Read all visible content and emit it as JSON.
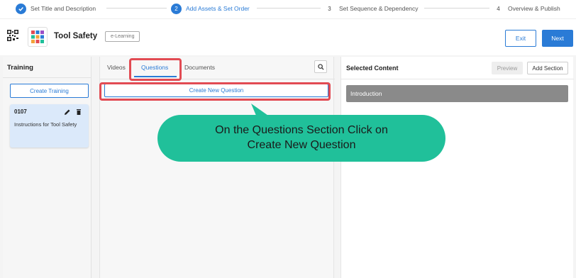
{
  "stepper": {
    "steps": [
      {
        "number": "1",
        "label": "Set Title and Description",
        "state": "done"
      },
      {
        "number": "2",
        "label": "Add Assets & Set Order",
        "state": "active"
      },
      {
        "number": "3",
        "label": "Set Sequence & Dependency",
        "state": "todo"
      },
      {
        "number": "4",
        "label": "Overview & Publish",
        "state": "todo"
      }
    ]
  },
  "header": {
    "title": "Tool Safety",
    "tag": "e-Learning",
    "exit_label": "Exit",
    "next_label": "Next"
  },
  "training": {
    "title": "Training",
    "create_label": "Create Training",
    "card": {
      "id": "0107",
      "description": "Instructions for Tool Safety"
    }
  },
  "assets": {
    "tabs": [
      {
        "label": "Videos",
        "active": false
      },
      {
        "label": "Questions",
        "active": true
      },
      {
        "label": "Documents",
        "active": false
      }
    ],
    "create_question_label": "Create New Question"
  },
  "selected": {
    "title": "Selected Content",
    "preview_label": "Preview",
    "add_section_label": "Add Section",
    "sections": [
      {
        "label": "Introduction"
      }
    ]
  },
  "callout": {
    "line1": "On the Questions Section Click on",
    "line2": "Create New Question"
  },
  "colors": {
    "accent": "#2a7bd6",
    "highlight": "#e24b53",
    "callout": "#20c09a"
  }
}
